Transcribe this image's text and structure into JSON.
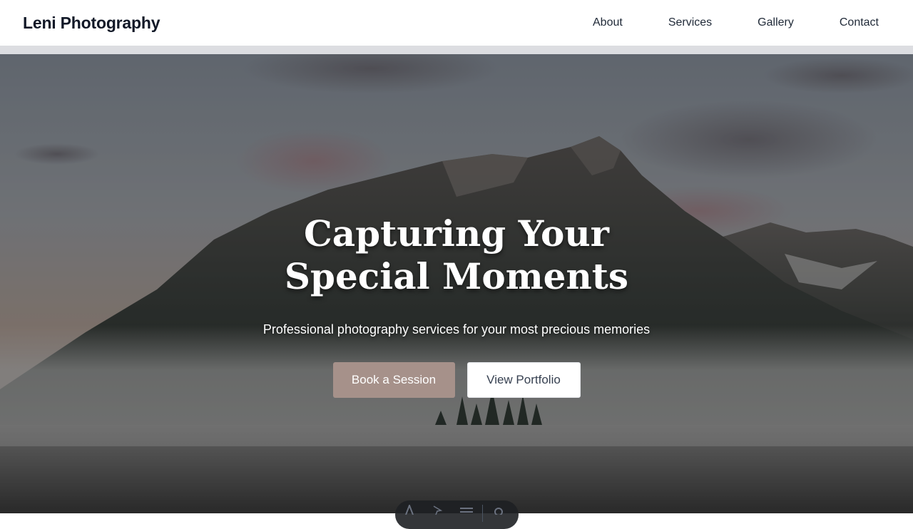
{
  "header": {
    "brand": "Leni Photography",
    "nav": [
      "About",
      "Services",
      "Gallery",
      "Contact"
    ]
  },
  "hero": {
    "title": "Capturing Your Special Moments",
    "subtitle": "Professional photography services for your most precious memories",
    "primary_button": "Book a Session",
    "secondary_button": "View Portfolio"
  },
  "toolbar": {
    "icons": [
      "text-icon",
      "pointer-icon",
      "menu-icon",
      "gear-icon"
    ]
  },
  "colors": {
    "primary_button": "#a6918a",
    "brand_text": "#111827"
  }
}
